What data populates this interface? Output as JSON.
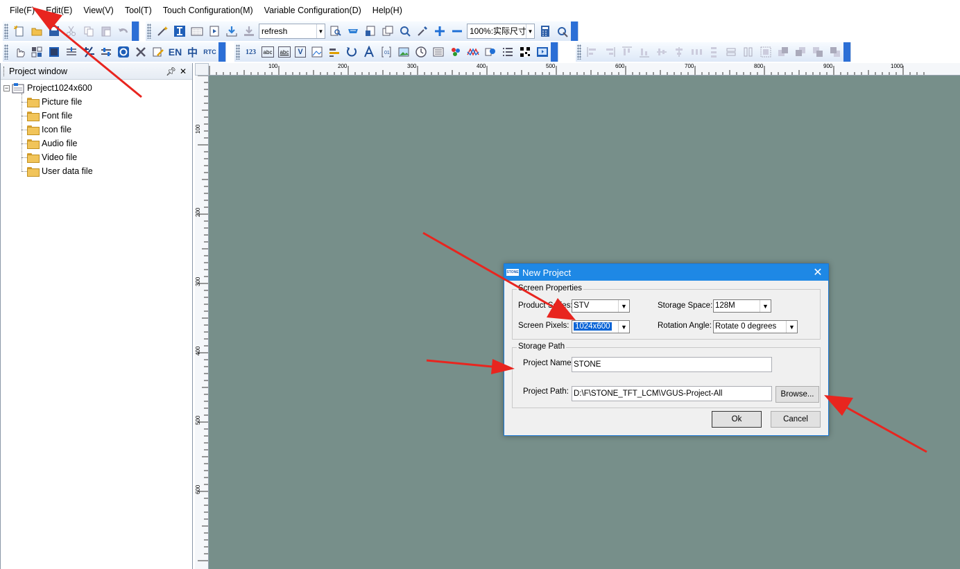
{
  "menu": [
    "File(F)",
    "Edit(E)",
    "View(V)",
    "Tool(T)",
    "Touch Configuration(M)",
    "Variable Configuration(D)",
    "Help(H)"
  ],
  "toolbar": {
    "refresh_combo": "refresh",
    "zoom_combo": "100%:实际尺寸"
  },
  "toolbar2_text_buttons": {
    "en": "EN",
    "zh": "中",
    "rtc": "RTC",
    "num": "123",
    "abc1": "abc",
    "abc2": "abc",
    "v": "V"
  },
  "project_window": {
    "title": "Project window",
    "pin": "⩗",
    "close": "✕",
    "root": "Project1024x600",
    "items": [
      "Picture file",
      "Font file",
      "Icon file",
      "Audio file",
      "Video file",
      "User data file"
    ]
  },
  "ruler": {
    "h_labels": [
      "100",
      "200",
      "300",
      "400",
      "500",
      "600",
      "700",
      "800",
      "900",
      "1000"
    ],
    "v_labels": [
      "100",
      "200",
      "300",
      "400",
      "500",
      "600"
    ]
  },
  "colors": {
    "canvas": "#778f8a",
    "dialog_title": "#1e88e5",
    "arrow": "#e8251f"
  },
  "dialog": {
    "title": "New Project",
    "logo_text": "STONE",
    "close": "✕",
    "screen_group": "Screen Properties",
    "product_series_label": "Product Series:",
    "product_series_value": "STV",
    "storage_space_label": "Storage Space:",
    "storage_space_value": "128M",
    "screen_pixels_label": "Screen Pixels:",
    "screen_pixels_value": "1024x600",
    "rotation_label": "Rotation Angle:",
    "rotation_value": "Rotate 0 degrees",
    "storage_group": "Storage Path",
    "project_name_label": "Project Name:",
    "project_name_value": "STONE",
    "project_path_label": "Project Path:",
    "project_path_value": "D:\\F\\STONE_TFT_LCM\\VGUS-Project-All",
    "browse": "Browse...",
    "ok": "Ok",
    "cancel": "Cancel"
  }
}
